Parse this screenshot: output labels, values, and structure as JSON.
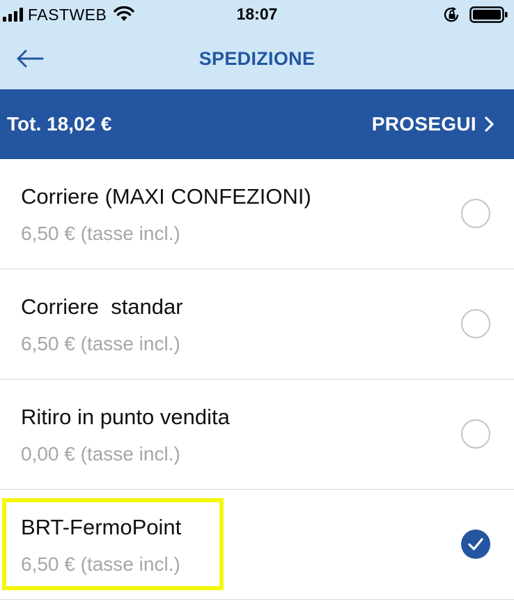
{
  "status_bar": {
    "carrier": "FASTWEB",
    "time": "18:07"
  },
  "nav": {
    "title": "SPEDIZIONE",
    "back_icon": "arrow-left-icon"
  },
  "summary": {
    "total": "Tot. 18,02 €",
    "continue_label": "PROSEGUI",
    "continue_icon": "chevron-right-icon"
  },
  "options": [
    {
      "name": "Corriere (MAXI CONFEZIONI)",
      "price": "6,50 € (tasse incl.)",
      "selected": false
    },
    {
      "name": "Corriere  standar",
      "price": "6,50 € (tasse incl.)",
      "selected": false
    },
    {
      "name": "Ritiro in punto vendita",
      "price": "0,00 € (tasse incl.)",
      "selected": false
    },
    {
      "name": "BRT-FermoPoint",
      "price": "6,50 € (tasse incl.)",
      "selected": true
    }
  ],
  "colors": {
    "header_bg": "#cfe6f6",
    "accent": "#2455a0",
    "highlight": "#f3f90d",
    "price_text": "#a6a6a6"
  }
}
